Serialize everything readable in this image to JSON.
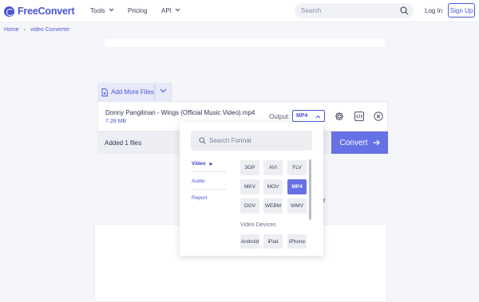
{
  "header": {
    "logo_text": "FreeConvert",
    "nav": [
      {
        "label": "Tools",
        "has_chevron": true
      },
      {
        "label": "Pricing",
        "has_chevron": false
      },
      {
        "label": "API",
        "has_chevron": true
      }
    ],
    "search_placeholder": "Search",
    "login_label": "Log In",
    "signup_label": "Sign Up"
  },
  "breadcrumb": {
    "home": "Home",
    "current": "video Converter"
  },
  "uploader": {
    "add_files_label": "Add More Files",
    "file_name": "Donny Pangilinan - Wings (Official Music Video).mp4",
    "file_size": "7.28 MB",
    "output_label": "Output:",
    "output_value": "MP4",
    "added_count_text": "Added 1 files",
    "convert_label": "Convert",
    "partial_text": "r"
  },
  "format_dropdown": {
    "search_placeholder": "Search Format",
    "categories": [
      "Video",
      "Audio",
      "Report"
    ],
    "active_category": "Video",
    "video_formats": [
      "3GP",
      "AVI",
      "FLV",
      "MKV",
      "MOV",
      "MP4",
      "OGV",
      "WEBM",
      "WMV"
    ],
    "selected_format": "MP4",
    "devices_label": "Video Devices",
    "devices": [
      "Android",
      "iPad",
      "iPhone"
    ]
  },
  "colors": {
    "accent": "#4b56d2",
    "convert_button": "#6671e5",
    "page_bg": "#f5f6f9"
  }
}
